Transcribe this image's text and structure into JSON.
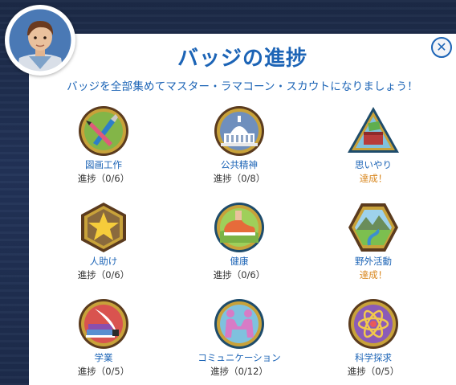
{
  "dialog": {
    "title": "バッジの進捗",
    "subtitle": "バッジを全部集めてマスター・ラマコーン・スカウトになりましょう！",
    "close_label": "✕"
  },
  "badges": [
    {
      "name": "図画工作",
      "progress": "進捗（0/6）",
      "icon": "paintbrush-icon",
      "completed": false
    },
    {
      "name": "公共精神",
      "progress": "進捗（0/8）",
      "icon": "capitol-building-icon",
      "completed": false
    },
    {
      "name": "思いやり",
      "progress": "達成！",
      "icon": "donation-box-icon",
      "completed": true
    },
    {
      "name": "人助け",
      "progress": "進捗（0/6）",
      "icon": "star-icon",
      "completed": false
    },
    {
      "name": "健康",
      "progress": "進捗（0/6）",
      "icon": "running-shoe-icon",
      "completed": false
    },
    {
      "name": "野外活動",
      "progress": "達成！",
      "icon": "mountain-river-icon",
      "completed": true
    },
    {
      "name": "学業",
      "progress": "進捗（0/5）",
      "icon": "books-quill-icon",
      "completed": false
    },
    {
      "name": "コミュニケーション",
      "progress": "進捗（0/12）",
      "icon": "handshake-people-icon",
      "completed": false
    },
    {
      "name": "科学探求",
      "progress": "進捗（0/5）",
      "icon": "atom-icon",
      "completed": false
    }
  ],
  "colors": {
    "accent": "#1c64b6",
    "completed": "#d8851b",
    "badge_gold": "#c8a23a",
    "badge_teal": "#2c6f86",
    "badge_brown": "#5b3b1e"
  }
}
